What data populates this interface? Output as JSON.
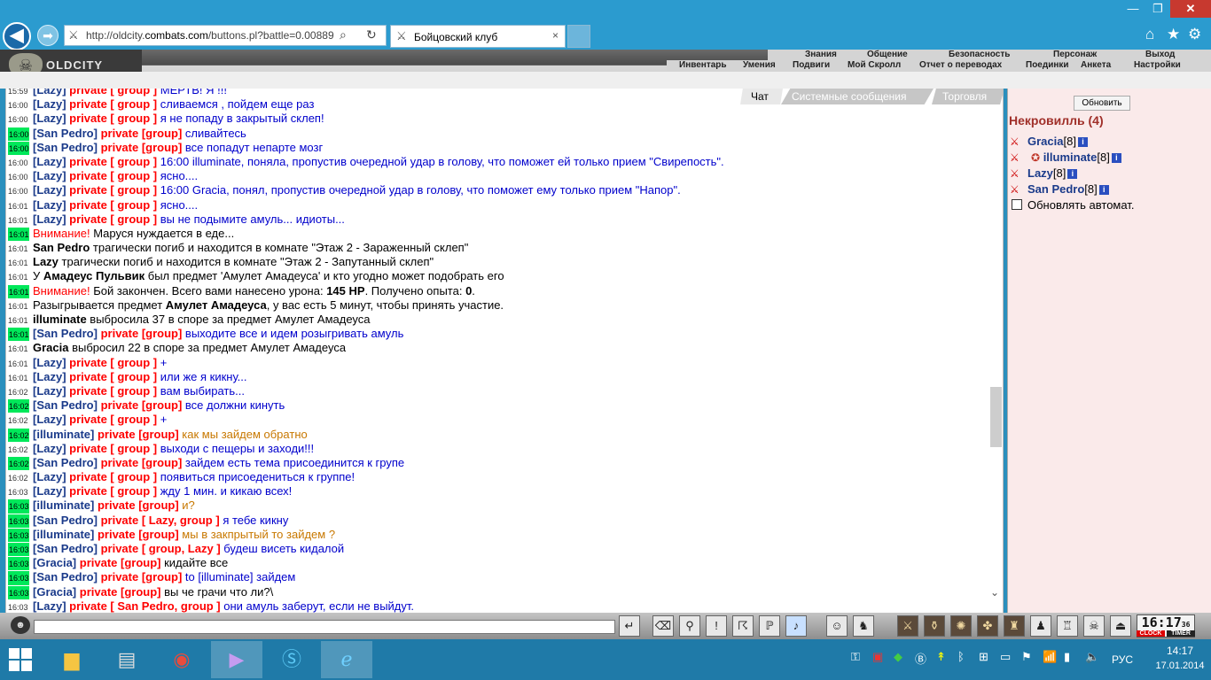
{
  "browser": {
    "url_prefix": "http://oldcity.",
    "url_host": "combats.com",
    "url_rest": "/buttons.pl?battle=0.00889",
    "tab_title": "Бойцовский клуб",
    "tab_close": "×",
    "back": "◀",
    "forward": "➡",
    "minimize": "—",
    "maximize": "❐",
    "close": "✕",
    "search_icon": "⌕",
    "refresh_icon": "↻",
    "home_icon": "⌂",
    "favorites_icon": "★",
    "settings_icon": "⚙"
  },
  "game": {
    "logo": "OLDCITY",
    "menu_top": [
      "Знания",
      "Общение",
      "Безопасность",
      "Персонаж",
      "Выход"
    ],
    "menu_bottom": [
      "Инвентарь",
      "Умения",
      "Подвиги",
      "Мой Скролл",
      "Отчет о переводах",
      "Поединки",
      "Анкета",
      "Настройки"
    ]
  },
  "chat": {
    "tabs": [
      "Чат",
      "Системные сообщения",
      "Торговля"
    ],
    "active_tab": "Чат",
    "lines": [
      {
        "ts": "15:59",
        "hl": false,
        "parts": [
          [
            "nick",
            "[Lazy]"
          ],
          [
            "priv",
            " private [ group ] "
          ],
          [
            "blue",
            "МЕРТВ! Я !!!"
          ]
        ]
      },
      {
        "ts": "16:00",
        "hl": false,
        "parts": [
          [
            "nick",
            "[Lazy]"
          ],
          [
            "priv",
            " private [ group ] "
          ],
          [
            "blue",
            "сливаемся , пойдем еще раз"
          ]
        ]
      },
      {
        "ts": "16:00",
        "hl": false,
        "parts": [
          [
            "nick",
            "[Lazy]"
          ],
          [
            "priv",
            " private [ group ] "
          ],
          [
            "blue",
            "я не попаду в закрытый склеп!"
          ]
        ]
      },
      {
        "ts": "16:00",
        "hl": true,
        "parts": [
          [
            "nick",
            "[San Pedro]"
          ],
          [
            "priv",
            " private [group] "
          ],
          [
            "blue",
            "сливайтесь"
          ]
        ]
      },
      {
        "ts": "16:00",
        "hl": true,
        "parts": [
          [
            "nick",
            "[San Pedro]"
          ],
          [
            "priv",
            " private [group] "
          ],
          [
            "blue",
            "все попадут непарте мозг"
          ]
        ]
      },
      {
        "ts": "16:00",
        "hl": false,
        "parts": [
          [
            "nick",
            "[Lazy]"
          ],
          [
            "priv",
            " private [ group ] "
          ],
          [
            "blue",
            "16:00 illuminate, поняла, пропустив очередной удар в голову, что поможет ей только прием \"Свирепость\"."
          ]
        ]
      },
      {
        "ts": "16:00",
        "hl": false,
        "parts": [
          [
            "nick",
            "[Lazy]"
          ],
          [
            "priv",
            " private [ group ] "
          ],
          [
            "blue",
            "ясно...."
          ]
        ]
      },
      {
        "ts": "16:00",
        "hl": false,
        "parts": [
          [
            "nick",
            "[Lazy]"
          ],
          [
            "priv",
            " private [ group ] "
          ],
          [
            "blue",
            "16:00 Gracia, понял, пропустив очередной удар в голову, что поможет ему только прием \"Напор\"."
          ]
        ]
      },
      {
        "ts": "16:01",
        "hl": false,
        "parts": [
          [
            "nick",
            "[Lazy]"
          ],
          [
            "priv",
            " private [ group ] "
          ],
          [
            "blue",
            "ясно...."
          ]
        ]
      },
      {
        "ts": "16:01",
        "hl": false,
        "parts": [
          [
            "nick",
            "[Lazy]"
          ],
          [
            "priv",
            " private [ group ] "
          ],
          [
            "blue",
            "вы не подымите амуль... идиоты..."
          ]
        ]
      },
      {
        "ts": "16:01",
        "hl": true,
        "parts": [
          [
            "warn",
            "Внимание! "
          ],
          [
            "plain",
            "Маруся нуждается в еде..."
          ]
        ]
      },
      {
        "ts": "16:01",
        "hl": false,
        "parts": [
          [
            "bold",
            "San Pedro"
          ],
          [
            "plain",
            " трагически погиб и находится в комнате \"Этаж 2 - Зараженный склеп\""
          ]
        ]
      },
      {
        "ts": "16:01",
        "hl": false,
        "parts": [
          [
            "bold",
            "Lazy"
          ],
          [
            "plain",
            " трагически погиб и находится в комнате \"Этаж 2 - Запутанный склеп\""
          ]
        ]
      },
      {
        "ts": "16:01",
        "hl": false,
        "parts": [
          [
            "plain",
            "У "
          ],
          [
            "bold",
            "Амадеус Пульвик"
          ],
          [
            "plain",
            " был предмет 'Амулет Амадеуса' и кто угодно может подобрать его"
          ]
        ]
      },
      {
        "ts": "16:01",
        "hl": true,
        "parts": [
          [
            "warn",
            "Внимание! "
          ],
          [
            "plain",
            "Бой закончен. Всего вами нанесено урона: "
          ],
          [
            "bold",
            "145 HP"
          ],
          [
            "plain",
            ". Получено опыта: "
          ],
          [
            "bold",
            "0"
          ],
          [
            "plain",
            "."
          ]
        ]
      },
      {
        "ts": "16:01",
        "hl": false,
        "parts": [
          [
            "plain",
            "Разыгрывается предмет "
          ],
          [
            "bold",
            "Амулет Амадеуса"
          ],
          [
            "plain",
            ", у вас есть 5 минут, чтобы принять участие."
          ]
        ]
      },
      {
        "ts": "16:01",
        "hl": false,
        "parts": [
          [
            "bold",
            "illuminate"
          ],
          [
            "plain",
            " выбросила 37 в споре за предмет Амулет Амадеуса"
          ]
        ]
      },
      {
        "ts": "16:01",
        "hl": true,
        "parts": [
          [
            "nick",
            "[San Pedro]"
          ],
          [
            "priv",
            " private [group] "
          ],
          [
            "blue",
            "выходите все и идем розыгривать амуль"
          ]
        ]
      },
      {
        "ts": "16:01",
        "hl": false,
        "parts": [
          [
            "bold",
            "Gracia"
          ],
          [
            "plain",
            " выбросил 22 в споре за предмет Амулет Амадеуса"
          ]
        ]
      },
      {
        "ts": "16:01",
        "hl": false,
        "parts": [
          [
            "nick",
            "[Lazy]"
          ],
          [
            "priv",
            " private [ group ] "
          ],
          [
            "blue",
            "+"
          ]
        ]
      },
      {
        "ts": "16:01",
        "hl": false,
        "parts": [
          [
            "nick",
            "[Lazy]"
          ],
          [
            "priv",
            " private [ group ] "
          ],
          [
            "blue",
            "или же я кикну..."
          ]
        ]
      },
      {
        "ts": "16:02",
        "hl": false,
        "parts": [
          [
            "nick",
            "[Lazy]"
          ],
          [
            "priv",
            " private [ group ] "
          ],
          [
            "blue",
            "вам выбирать..."
          ]
        ]
      },
      {
        "ts": "16:02",
        "hl": true,
        "parts": [
          [
            "nick",
            "[San Pedro]"
          ],
          [
            "priv",
            " private [group] "
          ],
          [
            "blue",
            "все должни кинуть"
          ]
        ]
      },
      {
        "ts": "16:02",
        "hl": false,
        "parts": [
          [
            "nick",
            "[Lazy]"
          ],
          [
            "priv",
            " private [ group ] "
          ],
          [
            "blue",
            "+"
          ]
        ]
      },
      {
        "ts": "16:02",
        "hl": true,
        "parts": [
          [
            "nick",
            "[illuminate]"
          ],
          [
            "priv",
            " private [group] "
          ],
          [
            "orange",
            "как мы зайдем обратно"
          ]
        ]
      },
      {
        "ts": "16:02",
        "hl": false,
        "parts": [
          [
            "nick",
            "[Lazy]"
          ],
          [
            "priv",
            " private [ group ] "
          ],
          [
            "blue",
            "выходи с пещеры и заходи!!!"
          ]
        ]
      },
      {
        "ts": "16:02",
        "hl": true,
        "parts": [
          [
            "nick",
            "[San Pedro]"
          ],
          [
            "priv",
            " private [group] "
          ],
          [
            "blue",
            "зайдем есть тема присоединится к групе"
          ]
        ]
      },
      {
        "ts": "16:02",
        "hl": false,
        "parts": [
          [
            "nick",
            "[Lazy]"
          ],
          [
            "priv",
            " private [ group ] "
          ],
          [
            "blue",
            "появиться присоедениться к группе!"
          ]
        ]
      },
      {
        "ts": "16:03",
        "hl": false,
        "parts": [
          [
            "nick",
            "[Lazy]"
          ],
          [
            "priv",
            " private [ group ] "
          ],
          [
            "blue",
            "жду 1 мин. и кикаю всех!"
          ]
        ]
      },
      {
        "ts": "16:03",
        "hl": true,
        "parts": [
          [
            "nick",
            "[illuminate]"
          ],
          [
            "priv",
            " private [group] "
          ],
          [
            "orange",
            "и?"
          ]
        ]
      },
      {
        "ts": "16:03",
        "hl": true,
        "parts": [
          [
            "nick",
            "[San Pedro]"
          ],
          [
            "priv",
            " private [ Lazy, group ] "
          ],
          [
            "blue",
            "я тебе кикну"
          ]
        ]
      },
      {
        "ts": "16:03",
        "hl": true,
        "parts": [
          [
            "nick",
            "[illuminate]"
          ],
          [
            "priv",
            " private [group] "
          ],
          [
            "orange",
            "мы в закпрытый то зайдем ?"
          ]
        ]
      },
      {
        "ts": "16:03",
        "hl": true,
        "parts": [
          [
            "nick",
            "[San Pedro]"
          ],
          [
            "priv",
            " private [ group, Lazy ] "
          ],
          [
            "blue",
            "будеш висеть кидалой"
          ]
        ]
      },
      {
        "ts": "16:03",
        "hl": true,
        "parts": [
          [
            "nick",
            "[Gracia]"
          ],
          [
            "priv",
            " private [group] "
          ],
          [
            "plain",
            "кидайте все"
          ]
        ]
      },
      {
        "ts": "16:03",
        "hl": true,
        "parts": [
          [
            "nick",
            "[San Pedro]"
          ],
          [
            "priv",
            " private [group] "
          ],
          [
            "blue",
            "to [illuminate] зайдем"
          ]
        ]
      },
      {
        "ts": "16:03",
        "hl": true,
        "parts": [
          [
            "nick",
            "[Gracia]"
          ],
          [
            "priv",
            " private [group] "
          ],
          [
            "plain",
            "вы че грачи что ли?\\"
          ]
        ]
      },
      {
        "ts": "16:03",
        "hl": false,
        "parts": [
          [
            "nick",
            "[Lazy]"
          ],
          [
            "priv",
            " private [ San Pedro, group ] "
          ],
          [
            "blue",
            "они амуль заберут, если не выйдут."
          ]
        ]
      }
    ]
  },
  "side": {
    "refresh_label": "Обновить",
    "location_title": "Некровилль (4)",
    "players": [
      {
        "name": "Gracia",
        "level": "[8]",
        "status": false
      },
      {
        "name": "illuminate",
        "level": "[8]",
        "status": true
      },
      {
        "name": "Lazy",
        "level": "[8]",
        "status": false
      },
      {
        "name": "San Pedro",
        "level": "[8]",
        "status": false
      }
    ],
    "info_glyph": "i",
    "auto_refresh_label": "Обновлять автомат."
  },
  "bottom": {
    "input_value": "",
    "clock_time": "16:17",
    "clock_seconds": "36",
    "clock_label": "CLOCK",
    "timer_label": "TIMER"
  },
  "taskbar": {
    "lang": "РУС",
    "time": "14:17",
    "date": "17.01.2014"
  }
}
